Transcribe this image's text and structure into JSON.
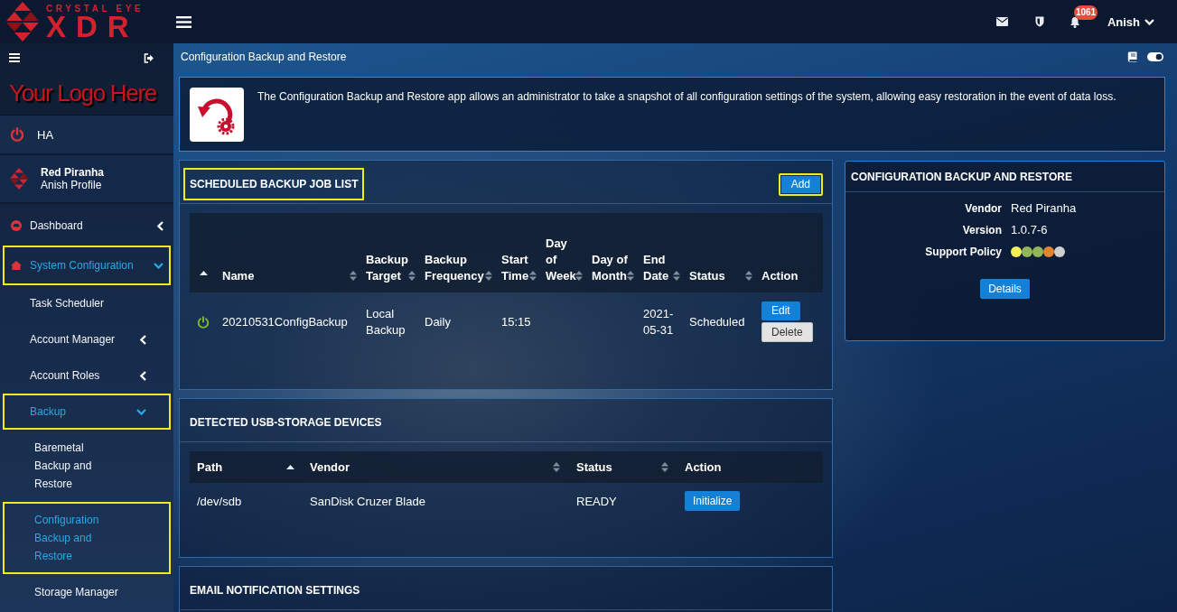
{
  "header": {
    "brand_small": "CRYSTAL EYE",
    "brand_large": "XDR",
    "notification_count": "1061",
    "user_name": "Anish"
  },
  "sidebar": {
    "custom_logo": "Your Logo Here",
    "ha_label": "HA",
    "profile": {
      "name": "Red Piranha",
      "subtitle": "Anish Profile"
    },
    "items": [
      {
        "label": "Dashboard",
        "selected": false,
        "expanded": false,
        "highlighted": false
      },
      {
        "label": "System Configuration",
        "selected": true,
        "expanded": true,
        "highlighted": true,
        "children": [
          {
            "label": "Task Scheduler",
            "selected": false,
            "highlighted": false
          },
          {
            "label": "Account Manager",
            "selected": false,
            "expanded": false,
            "highlighted": false
          },
          {
            "label": "Account Roles",
            "selected": false,
            "expanded": false,
            "highlighted": false
          },
          {
            "label": "Backup",
            "selected": true,
            "expanded": true,
            "highlighted": true,
            "children": [
              {
                "label": "Baremetal Backup and Restore",
                "selected": false,
                "highlighted": false
              },
              {
                "label": "Configuration Backup and Restore",
                "selected": true,
                "highlighted": true
              },
              {
                "label": "Storage Manager",
                "selected": false,
                "highlighted": false
              }
            ]
          }
        ]
      }
    ]
  },
  "page": {
    "title": "Configuration Backup and Restore",
    "view_toggle": {
      "on": true
    }
  },
  "intro": {
    "text": "The Configuration Backup and Restore app allows an administrator to take a snapshot of all configuration settings of the system, allowing easy restoration in the event of data loss."
  },
  "job_list": {
    "title": "SCHEDULED BACKUP JOB LIST",
    "title_highlighted": true,
    "add_button": {
      "label": "Add",
      "highlighted": true
    },
    "columns": [
      {
        "kind": "sorted"
      },
      {
        "label": "Name",
        "kind": "sortable"
      },
      {
        "label": "Backup Target",
        "kind": "sortable"
      },
      {
        "label": "Backup Frequency",
        "kind": "sortable"
      },
      {
        "label": "Start Time",
        "kind": "sortable"
      },
      {
        "label": "Day of Week",
        "kind": "sortable"
      },
      {
        "label": "Day of Month",
        "kind": "sortable"
      },
      {
        "label": "End Date",
        "kind": "sortable"
      },
      {
        "label": "Status",
        "kind": "sortable"
      },
      {
        "label": "Action",
        "kind": "plain"
      }
    ],
    "rows": [
      {
        "enabled": true,
        "name": "20210531ConfigBackup",
        "backup_target": "Local Backup",
        "backup_frequency": "Daily",
        "start_time": "15:15",
        "end_date": "2021-05-31",
        "status": "Scheduled",
        "actions": [
          {
            "label": "Edit",
            "kind": "edit"
          },
          {
            "label": "Delete",
            "kind": "delete"
          }
        ]
      }
    ]
  },
  "usb_devices": {
    "title": "DETECTED USB-STORAGE DEVICES",
    "columns": [
      {
        "label": "Path",
        "kind": "sorted"
      },
      {
        "label": "Vendor",
        "kind": "sortable"
      },
      {
        "label": "Status",
        "kind": "sortable"
      },
      {
        "label": "Action",
        "kind": "plain"
      }
    ],
    "rows": [
      {
        "path": "/dev/sdb",
        "vendor": "SanDisk Cruzer Blade",
        "status": "READY",
        "action": "Initialize"
      }
    ]
  },
  "email_notifications": {
    "title": "EMAIL NOTIFICATION SETTINGS"
  },
  "app_info": {
    "title": "CONFIGURATION BACKUP AND RESTORE",
    "fields": [
      {
        "label": "Vendor",
        "kind": "text",
        "value": "Red Piranha"
      },
      {
        "label": "Version",
        "kind": "text",
        "value": "1.0.7-6"
      },
      {
        "label": "Support Policy",
        "kind": "dots",
        "dots": [
          {
            "color": "#f3ee5b"
          },
          {
            "color": "#92b65a"
          },
          {
            "color": "#92b65a"
          },
          {
            "color": "#e3832f"
          },
          {
            "color": "#cfcfcf"
          }
        ]
      }
    ],
    "details_button": "Details"
  }
}
